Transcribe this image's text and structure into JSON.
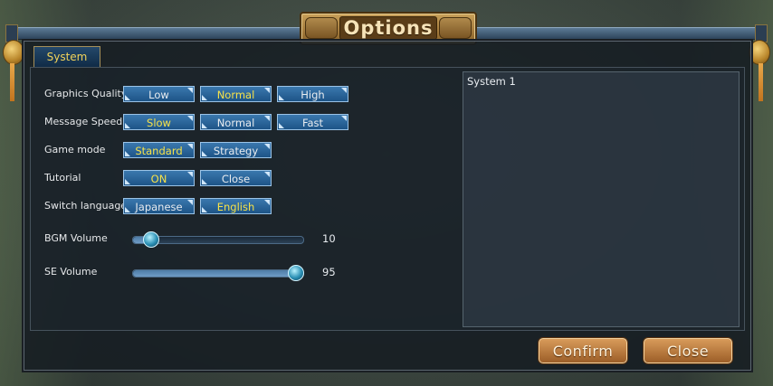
{
  "window": {
    "title": "Options"
  },
  "tabs": {
    "active": "System"
  },
  "settings": {
    "graphics_quality": {
      "label": "Graphics Quality",
      "options": [
        "Low",
        "Normal",
        "High"
      ],
      "selected": "Normal"
    },
    "message_speed": {
      "label": "Message Speed",
      "options": [
        "Slow",
        "Normal",
        "Fast"
      ],
      "selected": "Slow"
    },
    "game_mode": {
      "label": "Game mode",
      "options": [
        "Standard",
        "Strategy"
      ],
      "selected": "Standard"
    },
    "tutorial": {
      "label": "Tutorial",
      "options": [
        "ON",
        "Close"
      ],
      "selected": "ON"
    },
    "language": {
      "label": "Switch language",
      "options": [
        "Japanese",
        "English"
      ],
      "selected": "English"
    }
  },
  "volume": {
    "bgm": {
      "label": "BGM Volume",
      "value": "10",
      "level": 0.1
    },
    "se": {
      "label": "SE Volume",
      "value": "95",
      "level": 0.95
    }
  },
  "info_panel": {
    "title": "System 1"
  },
  "buttons": {
    "confirm": "Confirm",
    "close": "Close"
  },
  "colors": {
    "selected_text": "#f6e24a",
    "tab_text": "#f2d35a",
    "option_bg": "#2a66a0",
    "action_bg": "#c4823f"
  }
}
